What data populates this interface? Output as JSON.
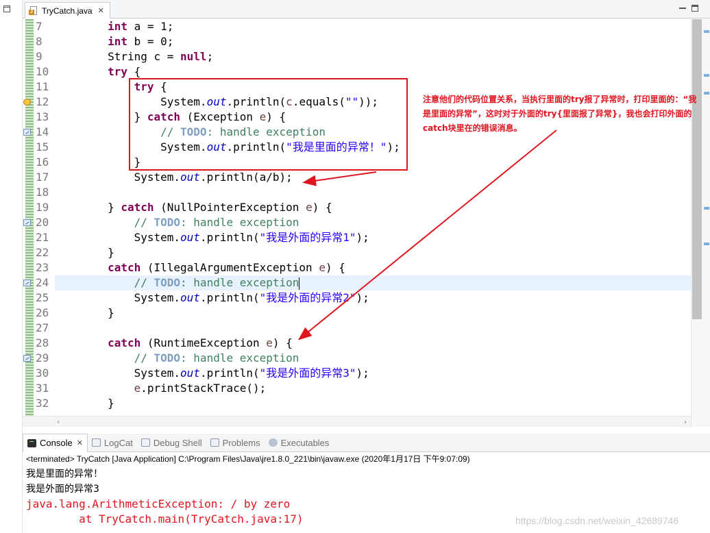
{
  "editor": {
    "tab_title": "TryCatch.java",
    "close_glyph": "✕"
  },
  "code": {
    "line_numbers": [
      "7",
      "8",
      "9",
      "10",
      "11",
      "12",
      "13",
      "14",
      "15",
      "16",
      "17",
      "18",
      "19",
      "20",
      "21",
      "22",
      "23",
      "24",
      "25",
      "26",
      "27",
      "28",
      "29",
      "30",
      "31",
      "32"
    ],
    "markers": {
      "12": "warning",
      "14": "task",
      "20": "task",
      "24": "task",
      "29": "task"
    },
    "current_line": "24",
    "lines": [
      [
        [
          "        ",
          ""
        ],
        [
          "int",
          "kw"
        ],
        [
          " a = 1;",
          ""
        ]
      ],
      [
        [
          "        ",
          ""
        ],
        [
          "int",
          "kw"
        ],
        [
          " b = 0;",
          ""
        ]
      ],
      [
        [
          "        String c = ",
          ""
        ],
        [
          "null",
          "kw"
        ],
        [
          ";",
          ""
        ]
      ],
      [
        [
          "        ",
          ""
        ],
        [
          "try",
          "kw"
        ],
        [
          " {",
          ""
        ]
      ],
      [
        [
          "            ",
          ""
        ],
        [
          "try",
          "kw"
        ],
        [
          " {",
          ""
        ]
      ],
      [
        [
          "                System.",
          ""
        ],
        [
          "out",
          "fld"
        ],
        [
          ".println(",
          ""
        ],
        [
          "c",
          "var"
        ],
        [
          ".equals(",
          ""
        ],
        [
          "\"\"",
          "str"
        ],
        [
          "));",
          ""
        ]
      ],
      [
        [
          "            } ",
          ""
        ],
        [
          "catch",
          "kw"
        ],
        [
          " (Exception ",
          ""
        ],
        [
          "e",
          "var"
        ],
        [
          ") {",
          ""
        ]
      ],
      [
        [
          "                ",
          ""
        ],
        [
          "// ",
          "cmt"
        ],
        [
          "TODO",
          "todo"
        ],
        [
          ": handle exception",
          "cmt"
        ]
      ],
      [
        [
          "                System.",
          ""
        ],
        [
          "out",
          "fld"
        ],
        [
          ".println(",
          ""
        ],
        [
          "\"我是里面的异常！\"",
          "str"
        ],
        [
          ");",
          ""
        ]
      ],
      [
        [
          "            }",
          ""
        ]
      ],
      [
        [
          "            System.",
          ""
        ],
        [
          "out",
          "fld"
        ],
        [
          ".println(a/b);",
          ""
        ]
      ],
      [
        [
          "",
          ""
        ]
      ],
      [
        [
          "        } ",
          ""
        ],
        [
          "catch",
          "kw"
        ],
        [
          " (NullPointerException ",
          ""
        ],
        [
          "e",
          "var"
        ],
        [
          ") {",
          ""
        ]
      ],
      [
        [
          "            ",
          ""
        ],
        [
          "// ",
          "cmt"
        ],
        [
          "TODO",
          "todo"
        ],
        [
          ": handle exception",
          "cmt"
        ]
      ],
      [
        [
          "            System.",
          ""
        ],
        [
          "out",
          "fld"
        ],
        [
          ".println(",
          ""
        ],
        [
          "\"我是外面的异常1\"",
          "str"
        ],
        [
          ");",
          ""
        ]
      ],
      [
        [
          "        }",
          ""
        ]
      ],
      [
        [
          "        ",
          ""
        ],
        [
          "catch",
          "kw"
        ],
        [
          " (IllegalArgumentException ",
          ""
        ],
        [
          "e",
          "var"
        ],
        [
          ") {",
          ""
        ]
      ],
      [
        [
          "            ",
          ""
        ],
        [
          "// ",
          "cmt"
        ],
        [
          "TODO",
          "todo"
        ],
        [
          ": handle exception",
          "cmt"
        ],
        [
          "|caret",
          "caret"
        ]
      ],
      [
        [
          "            System.",
          ""
        ],
        [
          "out",
          "fld"
        ],
        [
          ".println(",
          ""
        ],
        [
          "\"我是外面的异常2\"",
          "str"
        ],
        [
          ");",
          ""
        ]
      ],
      [
        [
          "        }",
          ""
        ]
      ],
      [
        [
          "",
          ""
        ]
      ],
      [
        [
          "        ",
          ""
        ],
        [
          "catch",
          "kw"
        ],
        [
          " (RuntimeException ",
          ""
        ],
        [
          "e",
          "var"
        ],
        [
          ") {",
          ""
        ]
      ],
      [
        [
          "            ",
          ""
        ],
        [
          "// ",
          "cmt"
        ],
        [
          "TODO",
          "todo"
        ],
        [
          ": handle exception",
          "cmt"
        ]
      ],
      [
        [
          "            System.",
          ""
        ],
        [
          "out",
          "fld"
        ],
        [
          ".println(",
          ""
        ],
        [
          "\"我是外面的异常3\"",
          "str"
        ],
        [
          ");",
          ""
        ]
      ],
      [
        [
          "            ",
          ""
        ],
        [
          "e",
          "var"
        ],
        [
          ".printStackTrace();",
          ""
        ]
      ],
      [
        [
          "        }",
          ""
        ]
      ]
    ]
  },
  "annotation": {
    "text": "注意他们的代码位置关系，当执行里面的try报了异常时，打印里面的：“我是里面的异常”，这时对于外面的try{里面报了异常}，我也会打印外面的catch块里在的错误消息。",
    "color": "#e0141f"
  },
  "console": {
    "tabs": [
      {
        "label": "Console",
        "icon": "console-icon",
        "active": true,
        "closable": true
      },
      {
        "label": "LogCat",
        "icon": "logcat-icon",
        "active": false
      },
      {
        "label": "Debug Shell",
        "icon": "debug-shell-icon",
        "active": false
      },
      {
        "label": "Problems",
        "icon": "problems-icon",
        "active": false
      },
      {
        "label": "Executables",
        "icon": "executables-icon",
        "active": false
      }
    ],
    "status": "<terminated> TryCatch [Java Application] C:\\Program Files\\Java\\jre1.8.0_221\\bin\\javaw.exe (2020年1月17日 下午9:07:09)",
    "output": [
      {
        "text": "我是里面的异常！",
        "type": "plain"
      },
      {
        "text": "我是外面的异常3",
        "type": "plain"
      },
      {
        "text": "java.lang.ArithmeticException: / by zero",
        "type": "err"
      },
      {
        "text": "\tat TryCatch.main(TryCatch.java:17)",
        "type": "err"
      }
    ]
  },
  "watermark": "https://blog.csdn.net/weixin_42689746"
}
